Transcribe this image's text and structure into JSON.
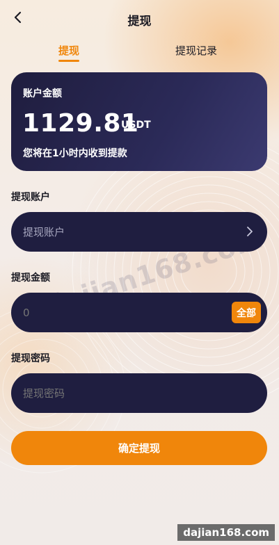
{
  "header": {
    "title": "提现",
    "back_icon": "chevron-left-icon"
  },
  "tabs": [
    {
      "label": "提现",
      "active": true
    },
    {
      "label": "提现记录",
      "active": false
    }
  ],
  "balance": {
    "label": "账户金额",
    "amount": "1129.81",
    "unit": "USDT",
    "note": "您将在1小时内收到提款"
  },
  "account": {
    "label": "提现账户",
    "placeholder": "提现账户",
    "chevron_icon": "chevron-right-icon"
  },
  "amount": {
    "label": "提现金额",
    "placeholder": "0",
    "all_label": "全部"
  },
  "password": {
    "label": "提现密码",
    "placeholder": "提现密码"
  },
  "confirm_label": "确定提现",
  "watermark": "dajian168.com",
  "footer_badge": "dajian168.com",
  "colors": {
    "accent": "#f0860b",
    "card_dark": "#1f1e40",
    "text": "#1b1b24"
  }
}
